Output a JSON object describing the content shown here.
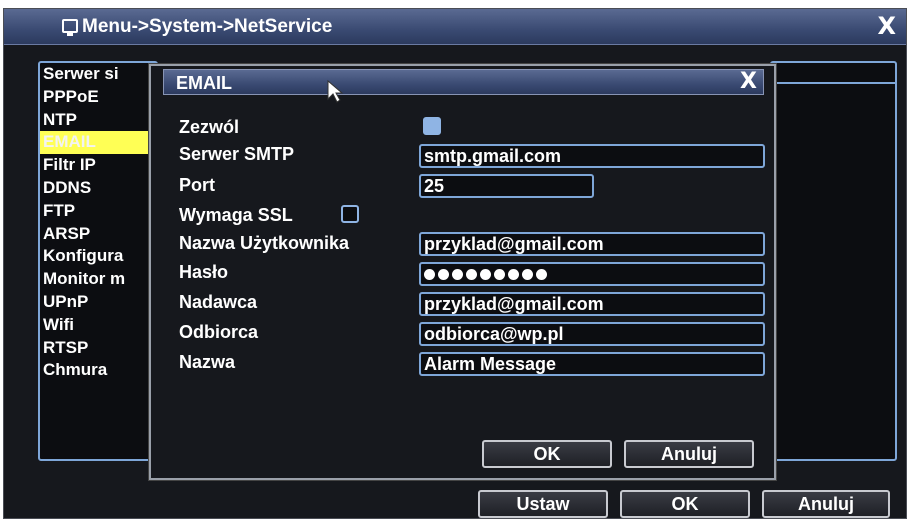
{
  "outer": {
    "title": "Menu->System->NetService",
    "close": "X",
    "list": [
      "Serwer si",
      "PPPoE",
      "NTP",
      "EMAIL",
      "Filtr IP",
      "DDNS",
      "FTP",
      "ARSP",
      "Konfigura",
      "Monitor m",
      "UPnP",
      "Wifi",
      "RTSP",
      "Chmura"
    ],
    "selected_index": 3,
    "buttons": {
      "set": "Ustaw",
      "ok": "OK",
      "cancel": "Anuluj"
    }
  },
  "email_dialog": {
    "title": "EMAIL",
    "close": "X",
    "enable_label": "Zezwól",
    "enable_checked": true,
    "smtp_label": "Serwer SMTP",
    "smtp_value": "smtp.gmail.com",
    "port_label": "Port",
    "port_value": "25",
    "ssl_label": "Wymaga SSL",
    "ssl_checked": false,
    "user_label": "Nazwa Użytkownika",
    "user_value": "przyklad@gmail.com",
    "password_label": "Hasło",
    "password_length": 9,
    "sender_label": "Nadawca",
    "sender_value": "przyklad@gmail.com",
    "receiver_label": "Odbiorca",
    "receiver_value": "odbiorca@wp.pl",
    "name_label": "Nazwa",
    "name_value": "Alarm Message",
    "ok": "OK",
    "cancel": "Anuluj"
  },
  "colors": {
    "accent_border": "#7ea6d8",
    "selected_item": "#ffff55",
    "titlebar": "#3a4a72"
  },
  "icons": [
    "monitor-icon",
    "close-icon",
    "cursor-arrow-icon"
  ]
}
